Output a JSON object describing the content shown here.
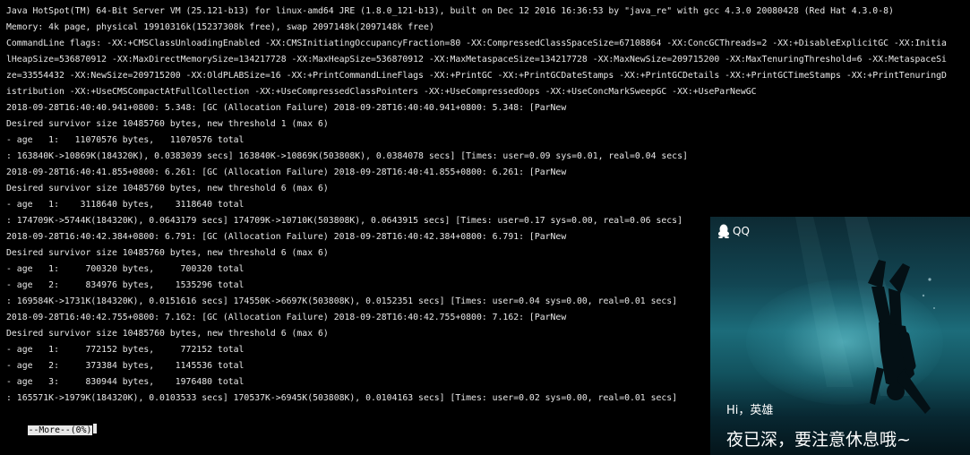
{
  "terminal": {
    "lines": [
      "Java HotSpot(TM) 64-Bit Server VM (25.121-b13) for linux-amd64 JRE (1.8.0_121-b13), built on Dec 12 2016 16:36:53 by \"java_re\" with gcc 4.3.0 20080428 (Red Hat 4.3.0-8)",
      "Memory: 4k page, physical 19910316k(15237308k free), swap 2097148k(2097148k free)",
      "CommandLine flags: -XX:+CMSClassUnloadingEnabled -XX:CMSInitiatingOccupancyFraction=80 -XX:CompressedClassSpaceSize=67108864 -XX:ConcGCThreads=2 -XX:+DisableExplicitGC -XX:Initia",
      "lHeapSize=536870912 -XX:MaxDirectMemorySize=134217728 -XX:MaxHeapSize=536870912 -XX:MaxMetaspaceSize=134217728 -XX:MaxNewSize=209715200 -XX:MaxTenuringThreshold=6 -XX:MetaspaceSi",
      "ze=33554432 -XX:NewSize=209715200 -XX:OldPLABSize=16 -XX:+PrintCommandLineFlags -XX:+PrintGC -XX:+PrintGCDateStamps -XX:+PrintGCDetails -XX:+PrintGCTimeStamps -XX:+PrintTenuringD",
      "istribution -XX:+UseCMSCompactAtFullCollection -XX:+UseCompressedClassPointers -XX:+UseCompressedOops -XX:+UseConcMarkSweepGC -XX:+UseParNewGC",
      "2018-09-28T16:40:40.941+0800: 5.348: [GC (Allocation Failure) 2018-09-28T16:40:40.941+0800: 5.348: [ParNew",
      "Desired survivor size 10485760 bytes, new threshold 1 (max 6)",
      "- age   1:   11070576 bytes,   11070576 total",
      ": 163840K->10869K(184320K), 0.0383039 secs] 163840K->10869K(503808K), 0.0384078 secs] [Times: user=0.09 sys=0.01, real=0.04 secs]",
      "2018-09-28T16:40:41.855+0800: 6.261: [GC (Allocation Failure) 2018-09-28T16:40:41.855+0800: 6.261: [ParNew",
      "Desired survivor size 10485760 bytes, new threshold 6 (max 6)",
      "- age   1:    3118640 bytes,    3118640 total",
      ": 174709K->5744K(184320K), 0.0643179 secs] 174709K->10710K(503808K), 0.0643915 secs] [Times: user=0.17 sys=0.00, real=0.06 secs]",
      "2018-09-28T16:40:42.384+0800: 6.791: [GC (Allocation Failure) 2018-09-28T16:40:42.384+0800: 6.791: [ParNew",
      "Desired survivor size 10485760 bytes, new threshold 6 (max 6)",
      "- age   1:     700320 bytes,     700320 total",
      "- age   2:     834976 bytes,    1535296 total",
      ": 169584K->1731K(184320K), 0.0151616 secs] 174550K->6697K(503808K), 0.0152351 secs] [Times: user=0.04 sys=0.00, real=0.01 secs]",
      "2018-09-28T16:40:42.755+0800: 7.162: [GC (Allocation Failure) 2018-09-28T16:40:42.755+0800: 7.162: [ParNew",
      "Desired survivor size 10485760 bytes, new threshold 6 (max 6)",
      "- age   1:     772152 bytes,     772152 total",
      "- age   2:     373384 bytes,    1145536 total",
      "- age   3:     830944 bytes,    1976480 total",
      ": 165571K->1979K(184320K), 0.0103533 secs] 170537K->6945K(503808K), 0.0104163 secs] [Times: user=0.02 sys=0.00, real=0.01 secs]"
    ],
    "pager_prompt": "--More--(0%)"
  },
  "notification": {
    "app_name": "QQ",
    "icon": "qq-penguin-icon",
    "greeting": "Hi，英雄",
    "message": "夜已深，要注意休息哦~",
    "background_image": "scuba-diver-silhouette"
  },
  "colors": {
    "terminal_bg": "#000000",
    "terminal_fg": "#e8e8e8",
    "popup_water": "#1c6c7a",
    "popup_text": "#ffffff"
  }
}
